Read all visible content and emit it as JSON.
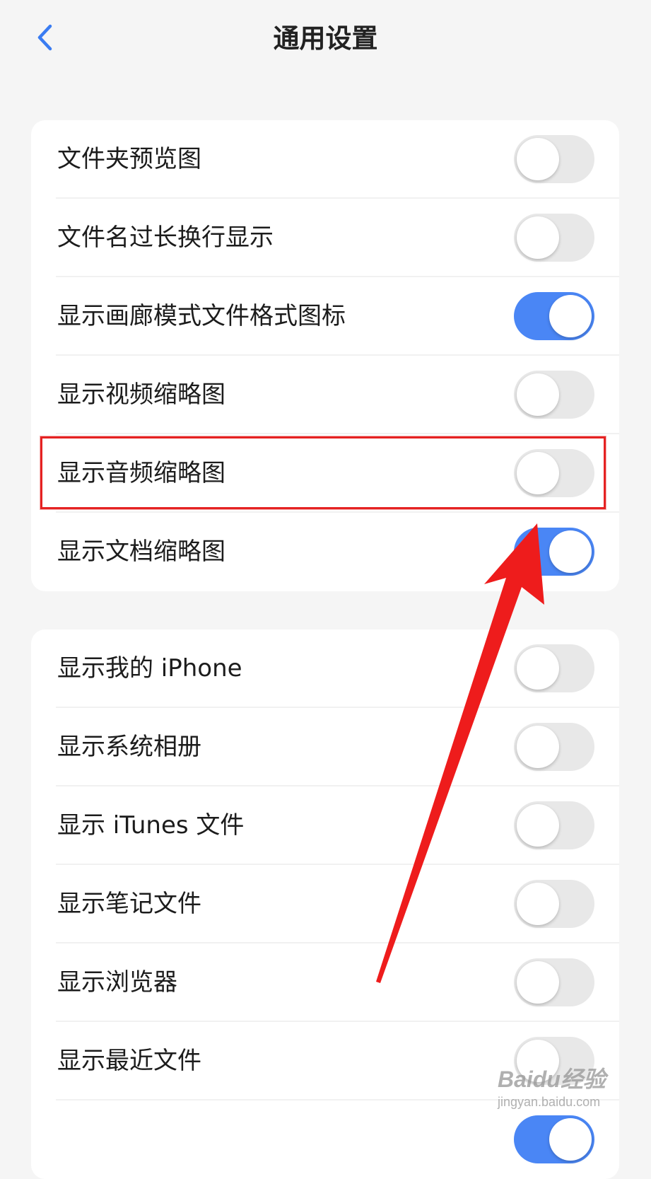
{
  "header": {
    "title": "通用设置"
  },
  "sections": [
    {
      "items": [
        {
          "label": "文件夹预览图",
          "on": false
        },
        {
          "label": "文件名过长换行显示",
          "on": false
        },
        {
          "label": "显示画廊模式文件格式图标",
          "on": true
        },
        {
          "label": "显示视频缩略图",
          "on": false
        },
        {
          "label": "显示音频缩略图",
          "on": false
        },
        {
          "label": "显示文档缩略图",
          "on": true
        }
      ]
    },
    {
      "items": [
        {
          "label": "显示我的 iPhone",
          "on": false
        },
        {
          "label": "显示系统相册",
          "on": false
        },
        {
          "label": "显示 iTunes 文件",
          "on": false
        },
        {
          "label": "显示笔记文件",
          "on": false
        },
        {
          "label": "显示浏览器",
          "on": false
        },
        {
          "label": "显示最近文件",
          "on": false
        },
        {
          "label": "",
          "on": true
        }
      ]
    }
  ],
  "colors": {
    "accent": "#4a86f5",
    "annotation": "#e52222",
    "background": "#f5f5f5"
  },
  "icons": {
    "back": "chevron-left-icon"
  },
  "watermark": {
    "main": "Baidu经验",
    "sub": "jingyan.baidu.com"
  }
}
